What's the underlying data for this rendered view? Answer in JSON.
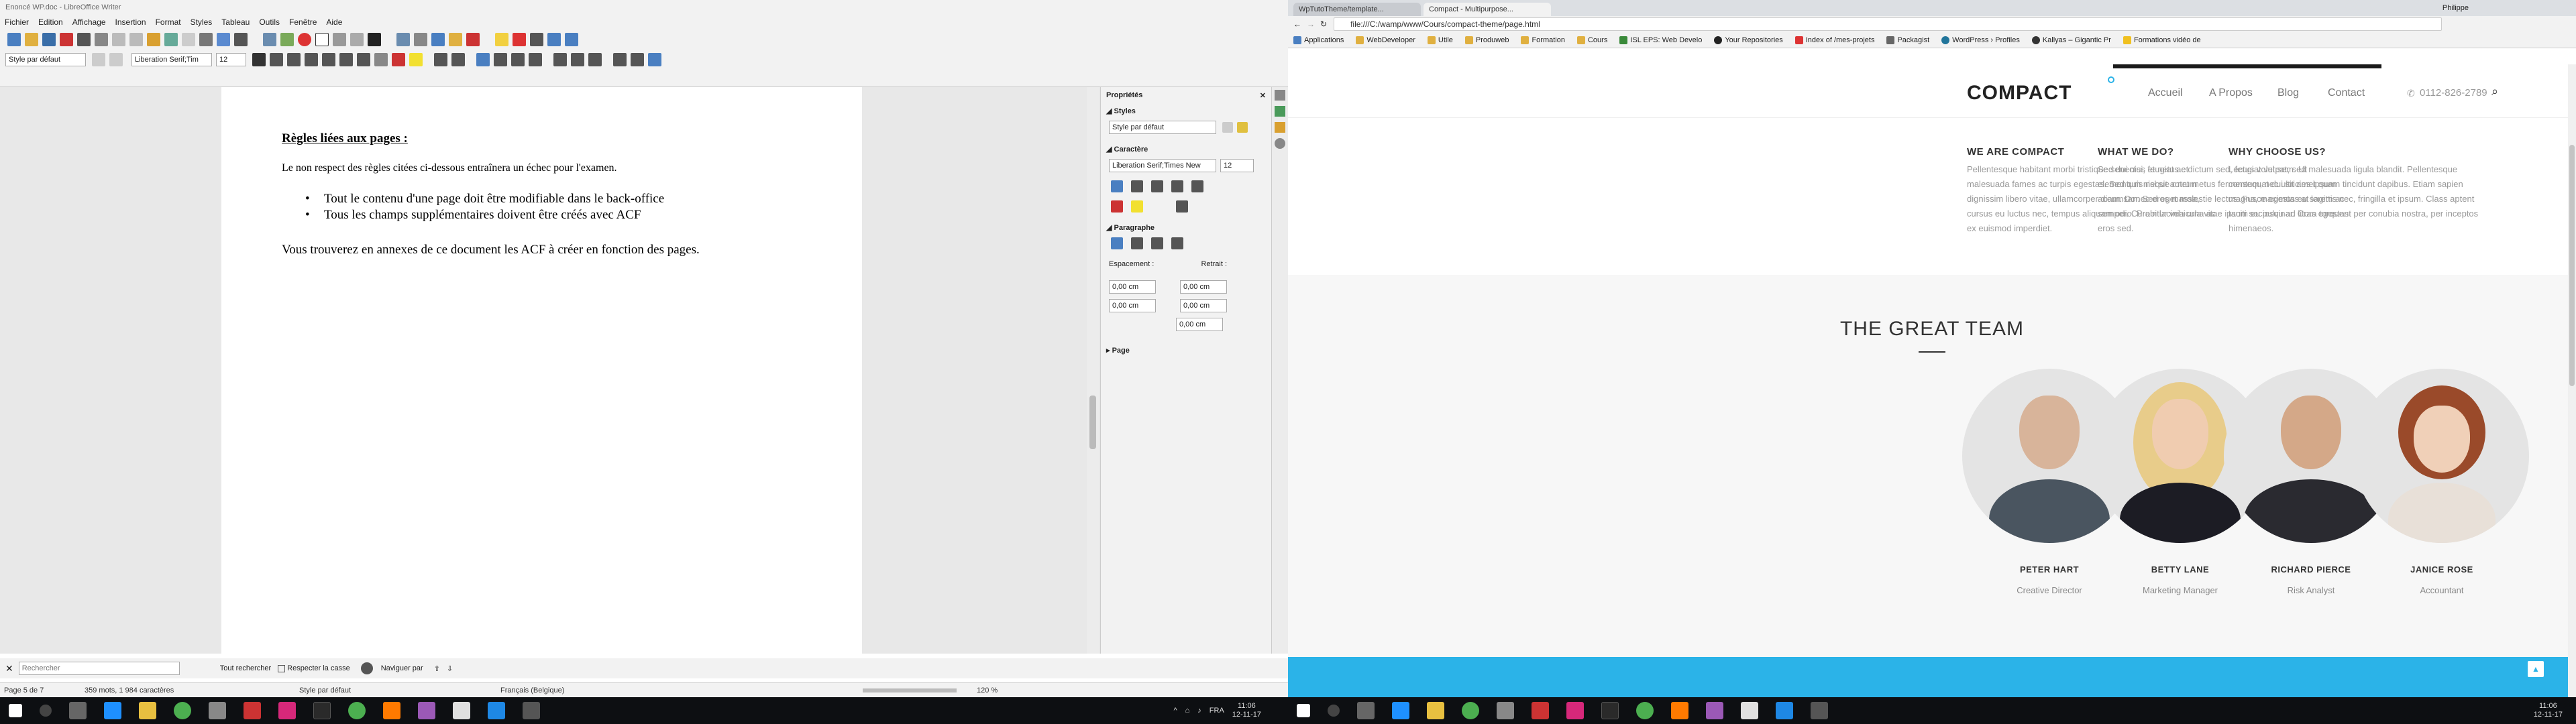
{
  "writer": {
    "title": "Enoncé WP.doc - LibreOffice Writer",
    "menu": [
      "Fichier",
      "Edition",
      "Affichage",
      "Insertion",
      "Format",
      "Styles",
      "Tableau",
      "Outils",
      "Fenêtre",
      "Aide"
    ],
    "para_style": "Style par défaut",
    "font_name": "Liberation Serif;Tim",
    "font_size": "12",
    "doc": {
      "heading": "Règles liées aux pages :",
      "intro": "Le non respect des règles citées ci-dessous entraînera un échec pour l'examen.",
      "bullets": [
        "Tout le contenu d'une page doit être modifiable dans le back-office",
        "Tous les champs supplémentaires doivent être créés avec ACF"
      ],
      "outro": "Vous trouverez en annexes de ce document les ACF à créer en fonction des pages."
    },
    "sidebar": {
      "title": "Propriétés",
      "styles_header": "Styles",
      "style_value": "Style par défaut",
      "char_header": "Caractère",
      "char_font": "Liberation Serif;Times New",
      "char_size": "12",
      "para_header": "Paragraphe",
      "spacing_label": "Espacement :",
      "indent_label": "Retrait :",
      "spin1": "0,00 cm",
      "spin2": "0,00 cm",
      "spin3": "0,00 cm",
      "spin4": "0,00 cm",
      "spin5": "0,00 cm",
      "page_header": "Page"
    },
    "find": {
      "placeholder": "Rechercher",
      "find_all": "Tout rechercher",
      "match_case": "Respecter la casse",
      "navigate": "Naviguer par"
    },
    "status": {
      "page": "Page 5 de 7",
      "words": "359 mots, 1 984 caractères",
      "style": "Style par défaut",
      "lang": "Français (Belgique)",
      "zoom": "120 %"
    }
  },
  "chrome": {
    "tabs": [
      "WpTutoTheme/template...",
      "Compact - Multipurpose..."
    ],
    "user": "Philippe",
    "url": "file:///C:/wamp/www/Cours/compact-theme/page.html",
    "bookmarks": [
      "Applications",
      "WebDeveloper",
      "Utile",
      "Produweb",
      "Formation",
      "Cours",
      "ISL EPS: Web Develo",
      "Your Repositories",
      "Index of /mes-projets",
      "Packagist",
      "WordPress › Profiles",
      "Kallyas – Gigantic Pr",
      "Formations vidéo de"
    ]
  },
  "site": {
    "logo": "COMPACT",
    "nav": [
      "Accueil",
      "A Propos",
      "Blog",
      "Contact"
    ],
    "phone": "0112-826-2789",
    "columns": [
      {
        "title": "WE ARE COMPACT",
        "text": "Pellentesque habitant morbi tristique senectus et netus et malesuada fames ac turpis egestas. Sed quis neque rutrum dignissim libero vitae, ullamcorper diam. Donec eros massa, cursus eu luctus nec, tempus aliquam odio. Proin lacinia urna ac ex euismod imperdiet."
      },
      {
        "title": "WHAT WE DO?",
        "text": "Sed dui nisi, feugiat ac dictum sed, feugiat vel sem. Ut elementum nisl sit amet metus fermentum, nec ultricies ipsum accumsan. Sed eget molestie lectus. Fusce egestas at lorem ac semper. Curabitur vehicula vitae ipsum eu pulvinar. Cras egestas eros sed."
      },
      {
        "title": "WHY CHOOSE US?",
        "text": "Lectus volutpat, sed malesuada ligula blandit. Pellentesque consequat dui sit amet quam tincidunt dapibus. Etiam sapien magna, maximus eu sagittis nec, fringilla et ipsum. Class aptent taciti sociosqu ad litora torquent per conubia nostra, per inceptos himenaeos."
      }
    ],
    "team_title": "THE GREAT TEAM",
    "team": [
      {
        "name": "PETER HART",
        "role": "Creative Director"
      },
      {
        "name": "BETTY LANE",
        "role": "Marketing Manager"
      },
      {
        "name": "RICHARD PIERCE",
        "role": "Risk Analyst"
      },
      {
        "name": "JANICE ROSE",
        "role": "Accountant"
      }
    ]
  },
  "taskbar": {
    "left_lang": "FRA",
    "left_time": "11:06",
    "left_date": "12-11-17",
    "right_time": "11:06",
    "right_date": "12-11-17"
  },
  "colors": {
    "accent": "#2bb3e8",
    "brand_dark": "#222222"
  }
}
